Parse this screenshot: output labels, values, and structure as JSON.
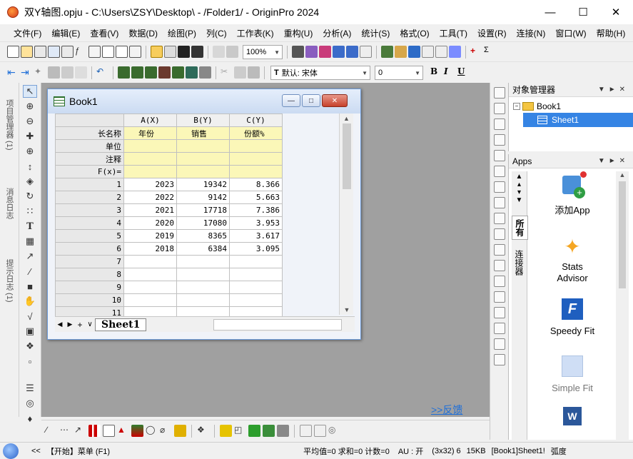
{
  "window": {
    "title": "双Y轴图.opju - C:\\Users\\ZSY\\Desktop\\ - /Folder1/ - OriginPro 2024"
  },
  "menu": [
    "文件(F)",
    "编辑(E)",
    "查看(V)",
    "数据(D)",
    "绘图(P)",
    "列(C)",
    "工作表(K)",
    "重构(U)",
    "分析(A)",
    "统计(S)",
    "格式(O)",
    "工具(T)",
    "设置(R)",
    "连接(N)",
    "窗口(W)",
    "帮助(H)"
  ],
  "toolbar": {
    "zoom": "100%",
    "font_name": "默认: 宋体",
    "font_size": "0",
    "bold": "B",
    "italic": "I",
    "underline": "U"
  },
  "left_tabs": [
    "项目管理器 (1)",
    "消息日志",
    "提示日志 (1)"
  ],
  "object_manager": {
    "title": "对象管理器",
    "book": "Book1",
    "sheet": "Sheet1"
  },
  "apps_panel": {
    "title": "Apps",
    "side_tabs": [
      "所有",
      "连接器"
    ],
    "items": [
      {
        "label": "添加App",
        "icon": "add-app-icon"
      },
      {
        "label": "Stats Advisor",
        "icon": "stats-advisor-icon"
      },
      {
        "label": "Speedy Fit",
        "icon": "speedy-fit-icon"
      },
      {
        "label": "Simple Fit",
        "icon": "simple-fit-icon"
      }
    ]
  },
  "book": {
    "title": "Book1",
    "sheet_tab": "Sheet1",
    "columns": [
      "A(X)",
      "B(Y)",
      "C(Y)"
    ],
    "row_labels": {
      "long_name": "长名称",
      "units": "单位",
      "comments": "注释",
      "fx": "F(x)="
    },
    "long_names": [
      "年份",
      "销售",
      "份额%"
    ],
    "rows": [
      [
        "2023",
        "19342",
        "8.366"
      ],
      [
        "2022",
        "9142",
        "5.663"
      ],
      [
        "2021",
        "17718",
        "7.386"
      ],
      [
        "2020",
        "17080",
        "3.953"
      ],
      [
        "2019",
        "8365",
        "3.617"
      ],
      [
        "2018",
        "6384",
        "3.095"
      ],
      [
        "",
        "",
        ""
      ],
      [
        "",
        "",
        ""
      ],
      [
        "",
        "",
        ""
      ],
      [
        "",
        "",
        ""
      ],
      [
        "",
        "",
        ""
      ]
    ]
  },
  "feedback_link": ">>反馈",
  "status": {
    "start_menu": "【开始】菜单 (F1)",
    "stats": "平均值=0 求和=0 计数=0",
    "au": "AU : 开",
    "dims": "(3x32) 6",
    "size": "15KB",
    "sheet_ref": "[Book1]Sheet1!",
    "angle": "弧度"
  }
}
